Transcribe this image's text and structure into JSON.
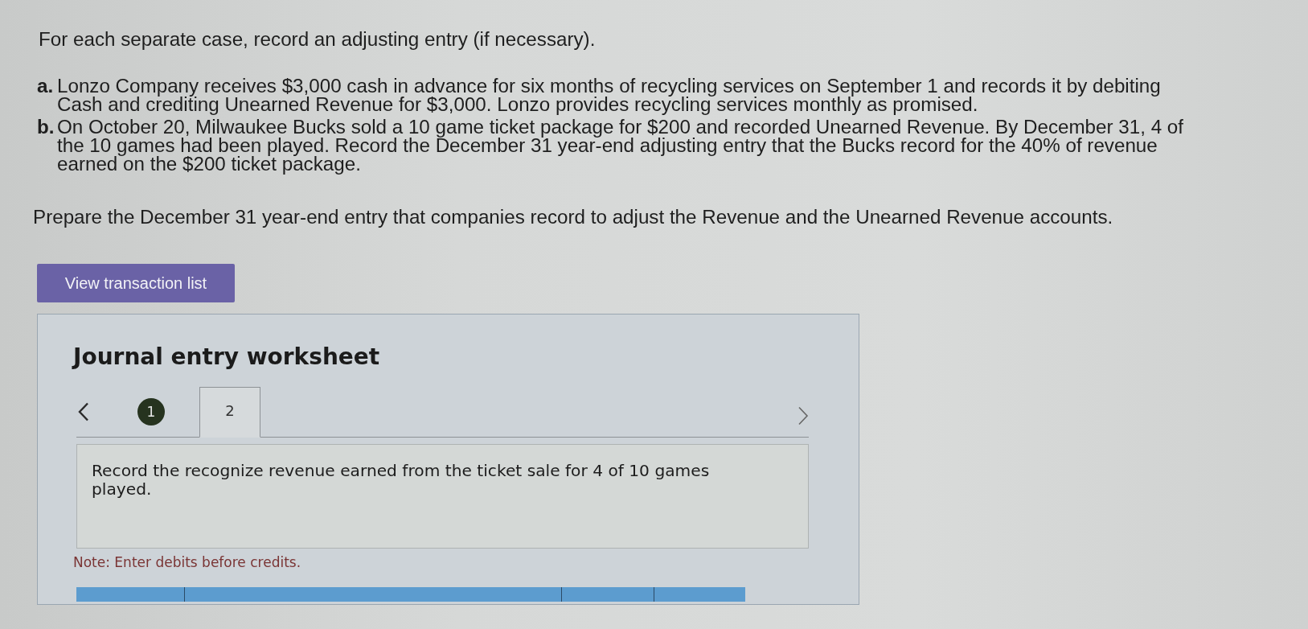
{
  "instructions": "For each separate case, record an adjusting entry (if necessary).",
  "cases": [
    {
      "label": "a.",
      "text": "Lonzo Company receives $3,000 cash in advance for six months of recycling services on September 1 and records it by debiting Cash and crediting Unearned Revenue for $3,000. Lonzo provides recycling services monthly as promised."
    },
    {
      "label": "b.",
      "text": "On October 20, Milwaukee Bucks sold a 10 game ticket package for $200 and recorded Unearned Revenue. By December 31, 4 of the 10 games had been played. Record the December 31 year-end adjusting entry that the Bucks record for the 40% of revenue earned on the $200 ticket package."
    }
  ],
  "task": "Prepare the December 31 year-end entry that companies record to adjust the Revenue and the Unearned Revenue accounts.",
  "view_button": {
    "label": "View transaction list"
  },
  "worksheet": {
    "title": "Journal entry worksheet",
    "steps": [
      {
        "label": "1",
        "selected": false,
        "done": true
      },
      {
        "label": "2",
        "selected": true,
        "done": false
      }
    ],
    "prompt": "Record the recognize revenue earned from the ticket sale for 4 of 10 games played.",
    "note": "Note: Enter debits before credits."
  }
}
